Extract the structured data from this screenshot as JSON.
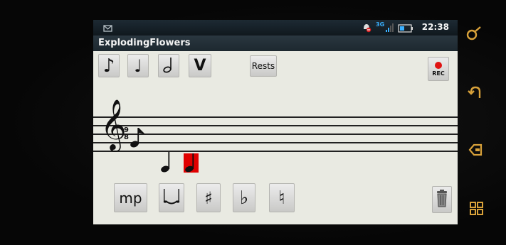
{
  "app": {
    "title": "ExplodingFlowers"
  },
  "status": {
    "time": "22:38",
    "network": "3G"
  },
  "toolbar": {
    "rests_label": "Rests",
    "rec_label": "REC",
    "note_eighth": "♪",
    "note_quarter": "♩",
    "note_half": "𝅗𝅥",
    "accent": "V"
  },
  "score": {
    "clef": "𝄞",
    "time_signature": {
      "top": "9",
      "bottom": "8"
    }
  },
  "bottombar": {
    "dynamic_label": "mp",
    "sharp": "♯",
    "flat": "♭",
    "natural": "♮"
  },
  "colors": {
    "accent": "#e01212",
    "highlight": "#e00000"
  },
  "icons": [
    "search-icon",
    "back-icon",
    "home-icon",
    "menu-icon",
    "trash-icon",
    "record-icon",
    "notification-icon",
    "signal-icon",
    "battery-icon"
  ]
}
